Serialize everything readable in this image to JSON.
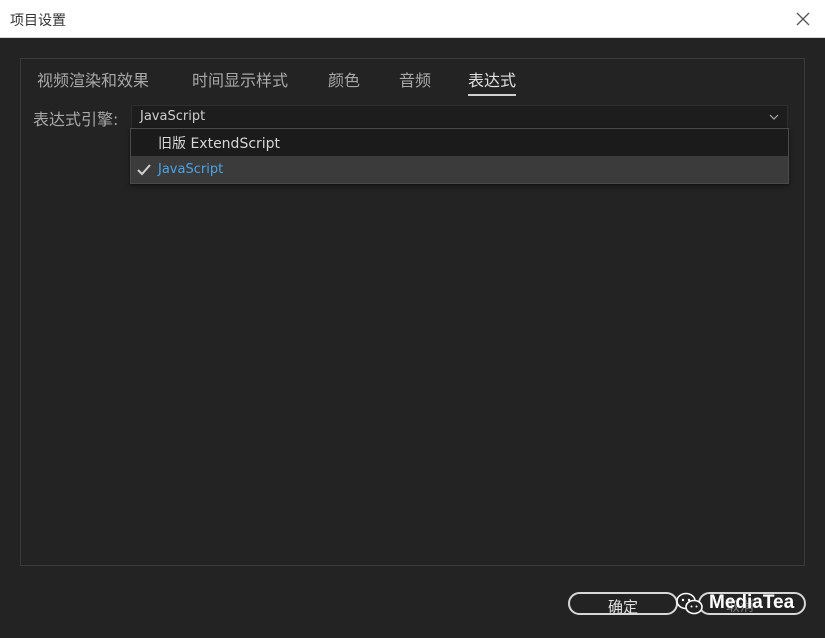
{
  "window": {
    "title": "项目设置"
  },
  "tabs": [
    {
      "label": "视频渲染和效果"
    },
    {
      "label": "时间显示样式"
    },
    {
      "label": "颜色"
    },
    {
      "label": "音频"
    },
    {
      "label": "表达式",
      "active": true
    }
  ],
  "engine": {
    "label": "表达式引擎:",
    "selected_value": "JavaScript",
    "options": [
      {
        "label": "旧版 ExtendScript",
        "checked": false
      },
      {
        "label": "JavaScript",
        "checked": true
      }
    ]
  },
  "footer": {
    "ok_label": "确定",
    "cancel_label": "取消"
  },
  "watermark": {
    "text": "MediaTea"
  },
  "colors": {
    "background": "#232323",
    "titlebar": "#ffffff",
    "selected_text": "#4aa3e8"
  }
}
